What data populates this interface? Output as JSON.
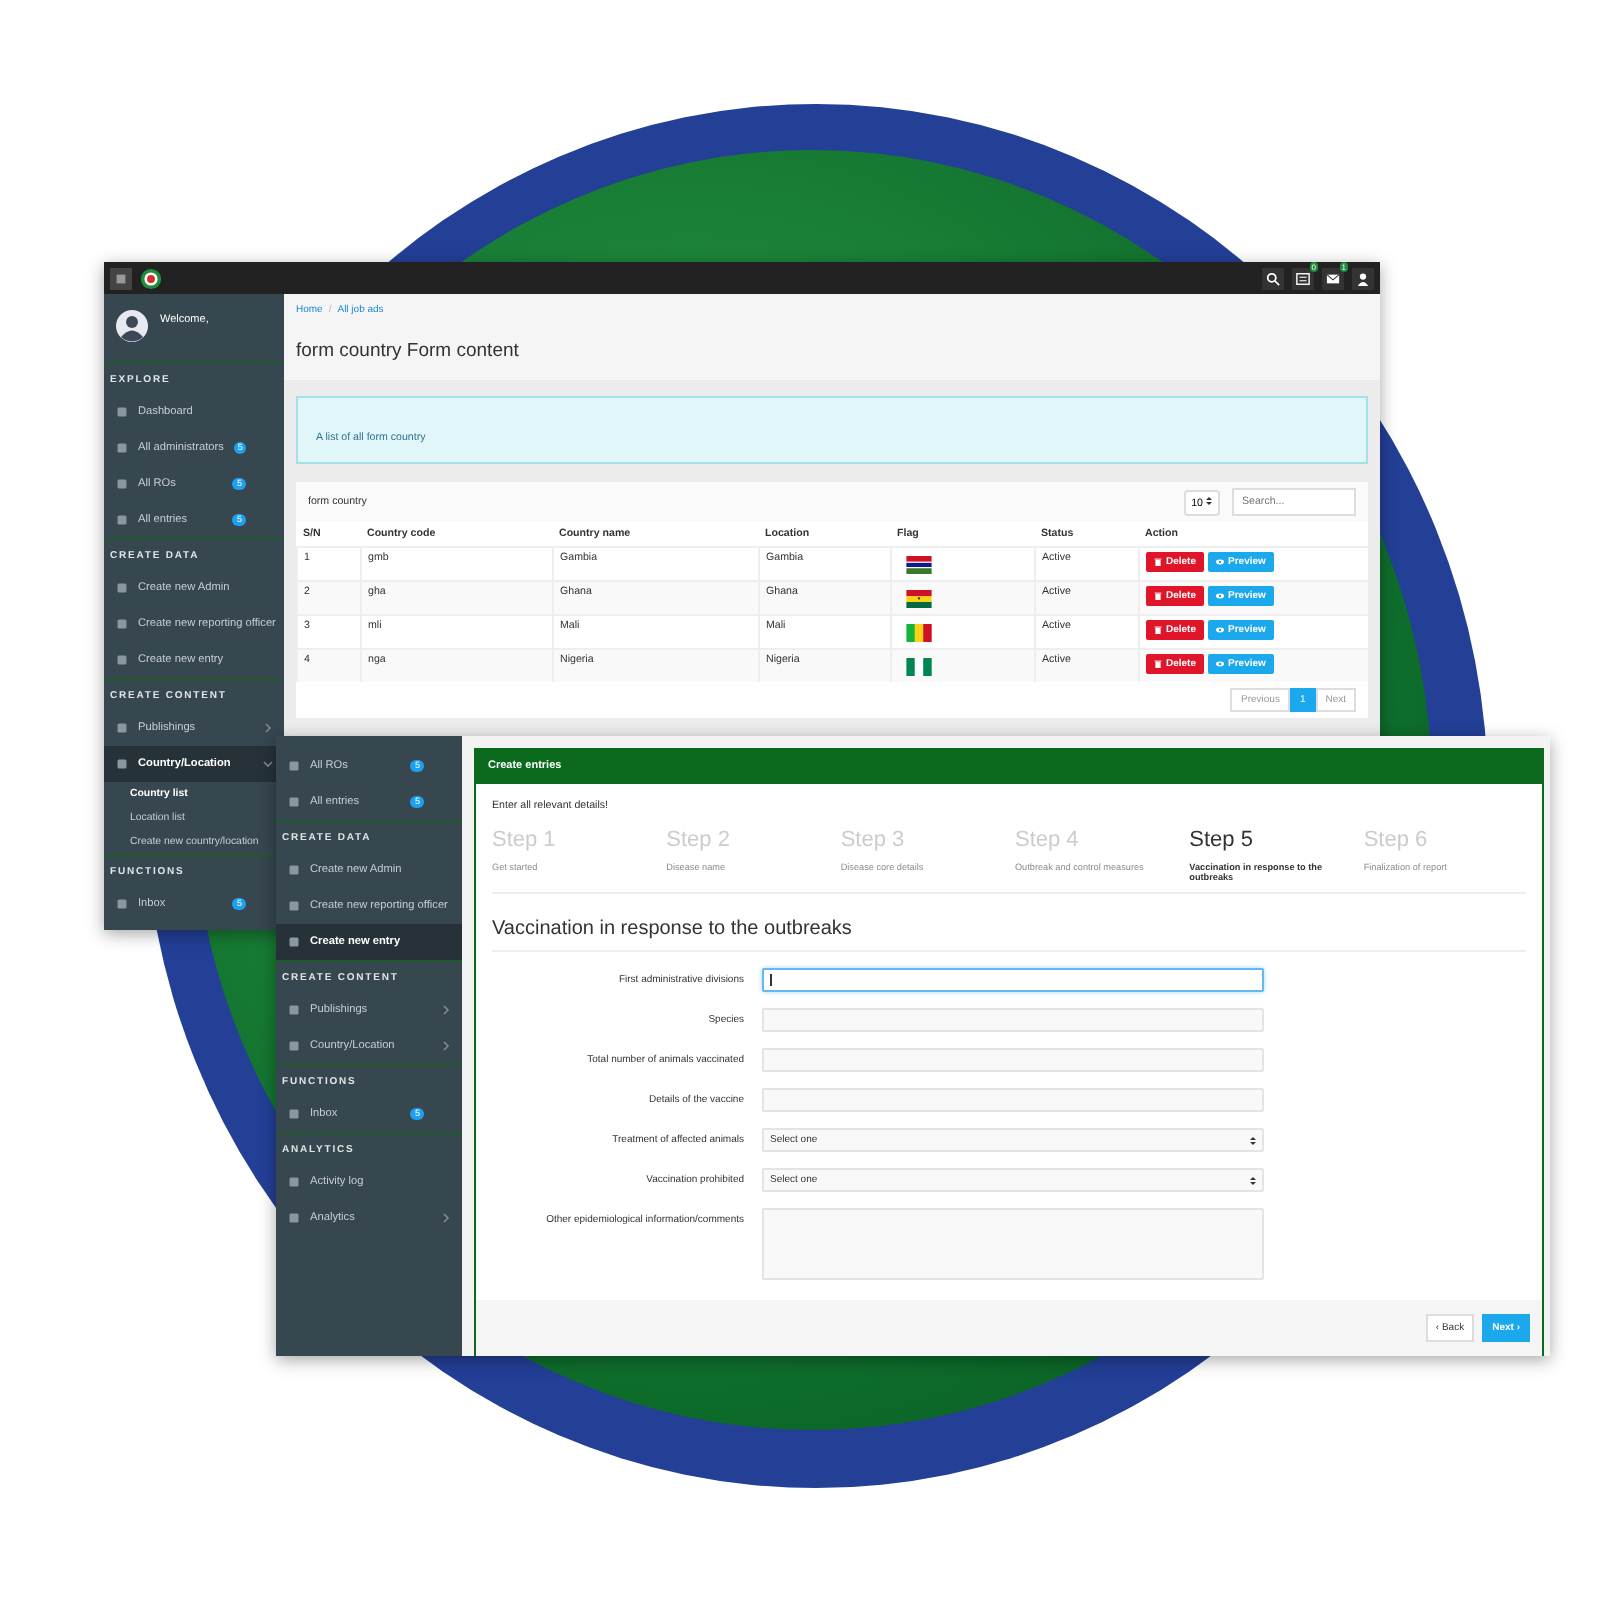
{
  "back_window": {
    "topbar": {
      "badges": [
        "0",
        "1"
      ]
    },
    "sidebar": {
      "welcome": "Welcome,",
      "sections": [
        {
          "title": "EXPLORE",
          "items": [
            {
              "label": "Dashboard",
              "selected": false
            },
            {
              "label": "All administrators",
              "badge": "5",
              "selected": false
            },
            {
              "label": "All ROs",
              "badge": "5",
              "selected": false
            },
            {
              "label": "All entries",
              "badge": "5",
              "selected": false
            }
          ]
        },
        {
          "title": "CREATE DATA",
          "items": [
            {
              "label": "Create new Admin",
              "selected": false
            },
            {
              "label": "Create new reporting officer",
              "selected": false
            },
            {
              "label": "Create new entry",
              "selected": false
            }
          ]
        },
        {
          "title": "CREATE CONTENT",
          "items": [
            {
              "label": "Publishings",
              "selected": false,
              "expanded": false
            },
            {
              "label": "Country/Location",
              "selected": true,
              "expanded": true,
              "children": [
                {
                  "label": "Country list",
                  "selected": true
                },
                {
                  "label": "Location list",
                  "selected": false
                },
                {
                  "label": "Create new country/location",
                  "selected": false
                }
              ]
            }
          ]
        },
        {
          "title": "FUNCTIONS",
          "items": [
            {
              "label": "Inbox",
              "badge": "5",
              "selected": false
            }
          ]
        }
      ]
    },
    "breadcrumb": [
      "Home",
      "All job ads"
    ],
    "breadcrumb_separator": "/",
    "page_title": "form country Form content",
    "alert": "A list of all form country",
    "table": {
      "title": "form country",
      "page_size": "10",
      "search_placeholder": "Search...",
      "columns": [
        "S/N",
        "Country code",
        "Country name",
        "Location",
        "Flag",
        "Status",
        "Action"
      ],
      "rows": [
        {
          "sn": "1",
          "code": "gmb",
          "name": "Gambia",
          "location": "Gambia",
          "kind": "gambia",
          "status": "Active",
          "actions": [
            "Delete",
            "Preview"
          ]
        },
        {
          "sn": "2",
          "code": "gha",
          "name": "Ghana",
          "location": "Ghana",
          "kind": "ghana",
          "status": "Active",
          "actions": [
            "Delete",
            "Preview"
          ]
        },
        {
          "sn": "3",
          "code": "mli",
          "name": "Mali",
          "location": "Mali",
          "kind": "mali",
          "status": "Active",
          "actions": [
            "Delete",
            "Preview"
          ]
        },
        {
          "sn": "4",
          "code": "nga",
          "name": "Nigeria",
          "location": "Nigeria",
          "kind": "nigeria",
          "status": "Active",
          "actions": [
            "Delete",
            "Preview"
          ]
        }
      ]
    },
    "pagination": {
      "previous": "Previous",
      "pages": [
        {
          "label": "1",
          "selected": true
        }
      ],
      "next": "Next"
    }
  },
  "front_window": {
    "sidebar": {
      "sections": [
        {
          "items": [
            {
              "label": "All ROs",
              "badge": "5",
              "selected": false
            },
            {
              "label": "All entries",
              "badge": "5",
              "selected": false
            }
          ]
        },
        {
          "title": "CREATE DATA",
          "items": [
            {
              "label": "Create new Admin",
              "selected": false
            },
            {
              "label": "Create new reporting officer",
              "selected": false
            },
            {
              "label": "Create new entry",
              "selected": true
            }
          ]
        },
        {
          "title": "CREATE CONTENT",
          "items": [
            {
              "label": "Publishings",
              "selected": false,
              "expanded": false
            },
            {
              "label": "Country/Location",
              "selected": false,
              "expanded": false
            }
          ]
        },
        {
          "title": "FUNCTIONS",
          "items": [
            {
              "label": "Inbox",
              "badge": "5",
              "selected": false
            }
          ]
        },
        {
          "title": "ANALYTICS",
          "items": [
            {
              "label": "Activity log",
              "selected": false
            },
            {
              "label": "Analytics",
              "selected": false,
              "expanded": false
            }
          ]
        }
      ]
    },
    "panel": {
      "title": "Create entries",
      "intro": "Enter all relevant details!",
      "steps": [
        {
          "title": "Step 1",
          "label": "Get started",
          "selected": false
        },
        {
          "title": "Step 2",
          "label": "Disease name",
          "selected": false
        },
        {
          "title": "Step 3",
          "label": "Disease core details",
          "selected": false
        },
        {
          "title": "Step 4",
          "label": "Outbreak and control measures",
          "selected": false
        },
        {
          "title": "Step 5",
          "label": "Vaccination in response to the outbreaks",
          "selected": true
        },
        {
          "title": "Step 6",
          "label": "Finalization of report",
          "selected": false
        }
      ],
      "section_title": "Vaccination in response to the outbreaks",
      "fields": [
        {
          "label": "First administrative divisions",
          "kind": "text",
          "focused": true
        },
        {
          "label": "Species",
          "kind": "text",
          "focused": false
        },
        {
          "label": "Total number of animals vaccinated",
          "kind": "text",
          "focused": false
        },
        {
          "label": "Details of the vaccine",
          "kind": "text",
          "focused": false
        },
        {
          "label": "Treatment of affected animals",
          "kind": "select",
          "value": "Select one",
          "focused": false
        },
        {
          "label": "Vaccination prohibited",
          "kind": "select",
          "value": "Select one",
          "focused": false
        },
        {
          "label": "Other epidemiological information/comments",
          "kind": "textarea",
          "focused": false
        }
      ],
      "back": "‹ Back",
      "next": "Next ›"
    }
  }
}
